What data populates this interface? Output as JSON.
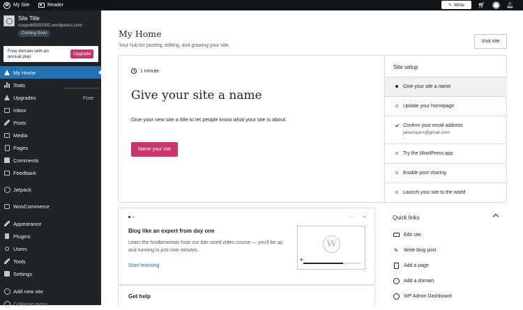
{
  "topbar": {
    "my_site": "My Site",
    "reader": "Reader",
    "write": "Write"
  },
  "site": {
    "title": "Site Title",
    "url": "coops69592092.wordpress.com",
    "badge": "Coming Soon"
  },
  "promo": {
    "text": "Free domain with an annual plan",
    "button": "Upgrade"
  },
  "nav": [
    {
      "label": "My Home",
      "icon": "home-icon",
      "active": true
    },
    {
      "label": "Stats",
      "icon": "stats-icon"
    },
    {
      "label": "Upgrades",
      "icon": "upgrades-icon",
      "extra": "Free"
    },
    {
      "label": "Inbox",
      "icon": "inbox-icon"
    },
    {
      "label": "Posts",
      "icon": "pin-icon"
    },
    {
      "label": "Media",
      "icon": "media-icon"
    },
    {
      "label": "Pages",
      "icon": "pages-icon"
    },
    {
      "label": "Comments",
      "icon": "comments-icon"
    },
    {
      "label": "Feedback",
      "icon": "feedback-icon"
    },
    {
      "label": "Jetpack",
      "icon": "jetpack-icon"
    },
    {
      "label": "WooCommerce",
      "icon": "woocommerce-icon"
    },
    {
      "label": "Appearance",
      "icon": "brush-icon"
    },
    {
      "label": "Plugins",
      "icon": "plug-icon"
    },
    {
      "label": "Users",
      "icon": "users-icon"
    },
    {
      "label": "Tools",
      "icon": "wrench-icon"
    },
    {
      "label": "Settings",
      "icon": "settings-icon"
    },
    {
      "label": "Add new site",
      "icon": "plus-circle-icon"
    },
    {
      "label": "Collapse menu",
      "icon": "collapse-icon"
    }
  ],
  "page": {
    "title": "My Home",
    "subtitle": "Your hub for posting, editing, and growing your site.",
    "visit_button": "Visit site"
  },
  "task": {
    "timer": "1 minute",
    "title": "Give your site a name",
    "description": "Give your new site a title to let people know what your site is about.",
    "button": "Name your site"
  },
  "setup": {
    "heading": "Site setup",
    "items": [
      {
        "label": "Give your site a name",
        "state": "current"
      },
      {
        "label": "Update your homepage",
        "state": "todo"
      },
      {
        "label": "Confirm your email address",
        "sub": "janecoperr@gmail.com",
        "state": "done"
      },
      {
        "label": "Try the WordPress app",
        "state": "todo"
      },
      {
        "label": "Enable post sharing",
        "state": "todo"
      },
      {
        "label": "Launch your site to the world",
        "state": "todo"
      }
    ]
  },
  "blog": {
    "title": "Blog like an expert from day one",
    "description": "Learn the fundamentals from our bite-sized video course — you'll be up and running in just nine minutes.",
    "link": "Start learning",
    "video_progress": 0.7
  },
  "help": {
    "title": "Get help"
  },
  "quick_links": {
    "heading": "Quick links",
    "items": [
      {
        "label": "Edit site",
        "icon": "laptop-icon"
      },
      {
        "label": "Write blog post",
        "icon": "pencil-icon"
      },
      {
        "label": "Add a page",
        "icon": "page-plus-icon"
      },
      {
        "label": "Add a domain",
        "icon": "globe-icon"
      },
      {
        "label": "WP Admin Dashboard",
        "icon": "wordpress-icon"
      }
    ]
  },
  "colors": {
    "sidebar": "#1d2327",
    "active": "#2271b1",
    "accent": "#c9356e",
    "topbar": "#101517"
  }
}
